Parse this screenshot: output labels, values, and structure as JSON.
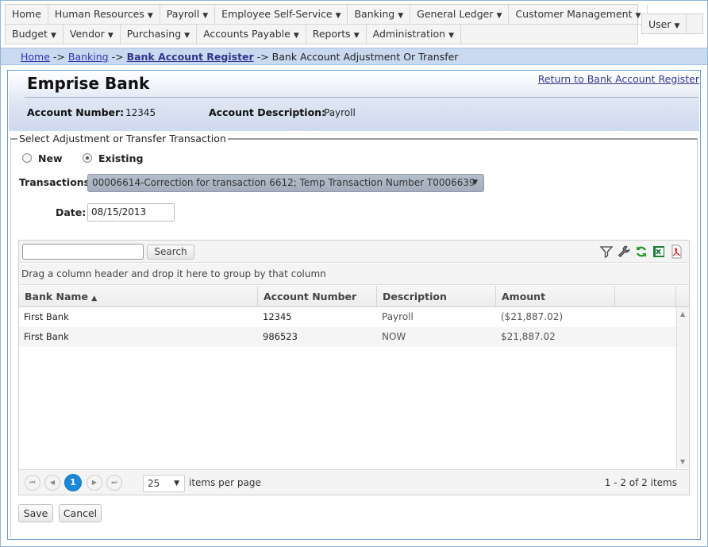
{
  "menu": {
    "row1": [
      "Home",
      "Human Resources",
      "Payroll",
      "Employee Self-Service",
      "Banking",
      "General Ledger",
      "Customer Management"
    ],
    "row2": [
      "Budget",
      "Vendor",
      "Purchasing",
      "Accounts Payable",
      "Reports",
      "Administration"
    ],
    "user": "User"
  },
  "breadcrumb": {
    "home": "Home",
    "sep1": "->",
    "banking": "Banking",
    "sep2": "->",
    "register": "Bank Account Register",
    "sep3": "->",
    "current": "Bank Account Adjustment Or Transfer"
  },
  "header": {
    "bank_name": "Emprise Bank",
    "return_link": "Return to Bank Account Register",
    "account_number_label": "Account Number:",
    "account_number": "12345",
    "account_description_label": "Account Description:",
    "account_description": "Payroll"
  },
  "form": {
    "legend": "Select Adjustment or Transfer Transaction",
    "radio_new": "New",
    "radio_existing": "Existing",
    "selected_radio": "existing",
    "transactions_label": "Transactions",
    "transactions_value": "00006614-Correction for transaction 6612; Temp Transaction Number T0006639",
    "date_label": "Date:",
    "date_value": "08/15/2013"
  },
  "grid": {
    "search_placeholder": "",
    "search_button": "Search",
    "toolbar_icons": [
      "filter-icon",
      "wrench-icon",
      "refresh-icon",
      "excel-icon",
      "pdf-icon"
    ],
    "group_hint": "Drag a column header and drop it here to group by that column",
    "columns": [
      "Bank Name",
      "Account Number",
      "Description",
      "Amount"
    ],
    "sort_indicator": "▲",
    "rows": [
      {
        "bank": "First Bank",
        "account": "12345",
        "description": "Payroll",
        "amount": "($21,887.02)"
      },
      {
        "bank": "First Bank",
        "account": "986523",
        "description": "NOW",
        "amount": "$21,887.02"
      }
    ],
    "pager": {
      "current_page": "1",
      "page_size": "25",
      "items_per_page_label": "items per page",
      "info": "1 - 2 of 2 items"
    }
  },
  "buttons": {
    "save": "Save",
    "cancel": "Cancel"
  },
  "colors": {
    "accent": "#1e88d8",
    "breadcrumb_bg": "#c9daf0",
    "panel_border": "#6c9dd2"
  }
}
